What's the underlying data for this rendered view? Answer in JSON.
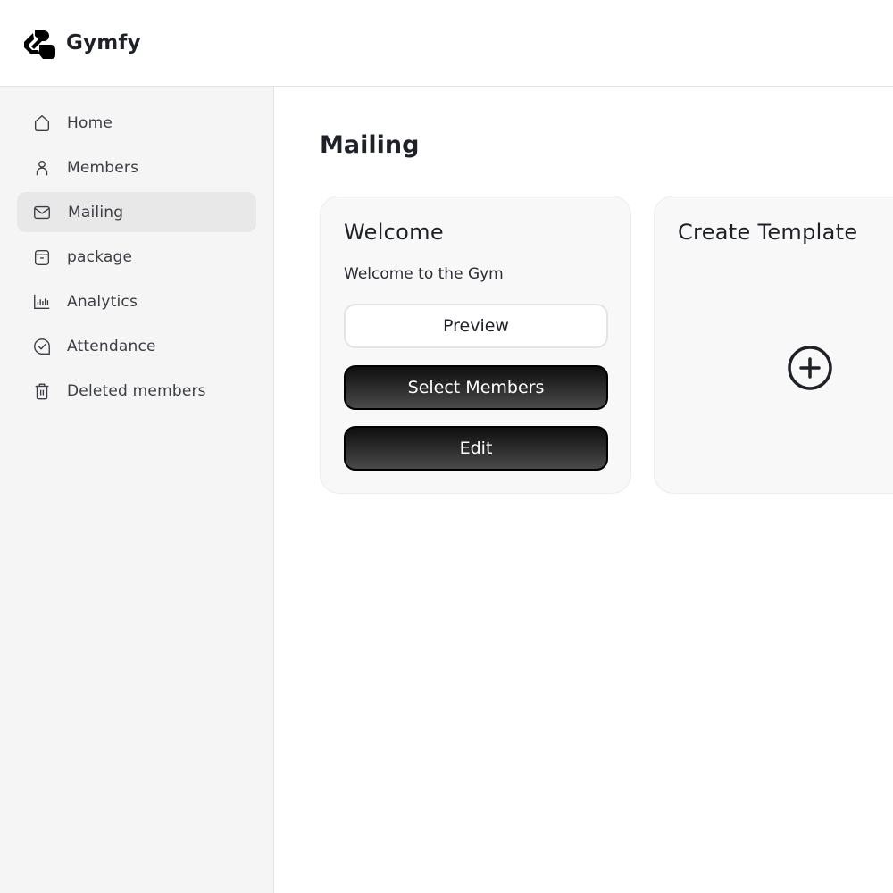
{
  "header": {
    "brand": "Gymfy",
    "logo_icon": "gymfy-logo-icon"
  },
  "sidebar": {
    "active_item": "Mailing",
    "items": [
      {
        "label": "Home",
        "icon": "home-icon"
      },
      {
        "label": "Members",
        "icon": "user-icon"
      },
      {
        "label": "Mailing",
        "icon": "mail-icon"
      },
      {
        "label": "package",
        "icon": "archive-box-icon"
      },
      {
        "label": "Analytics",
        "icon": "bar-chart-icon"
      },
      {
        "label": "Attendance",
        "icon": "check-circle-icon"
      },
      {
        "label": "Deleted members",
        "icon": "trash-icon"
      }
    ]
  },
  "main": {
    "title": "Mailing",
    "templates": [
      {
        "title": "Welcome",
        "description": "Welcome to the Gym",
        "buttons": {
          "preview": "Preview",
          "select_members": "Select Members",
          "edit": "Edit"
        }
      }
    ],
    "create_card": {
      "title": "Create Template",
      "icon": "plus-circle-icon"
    }
  }
}
